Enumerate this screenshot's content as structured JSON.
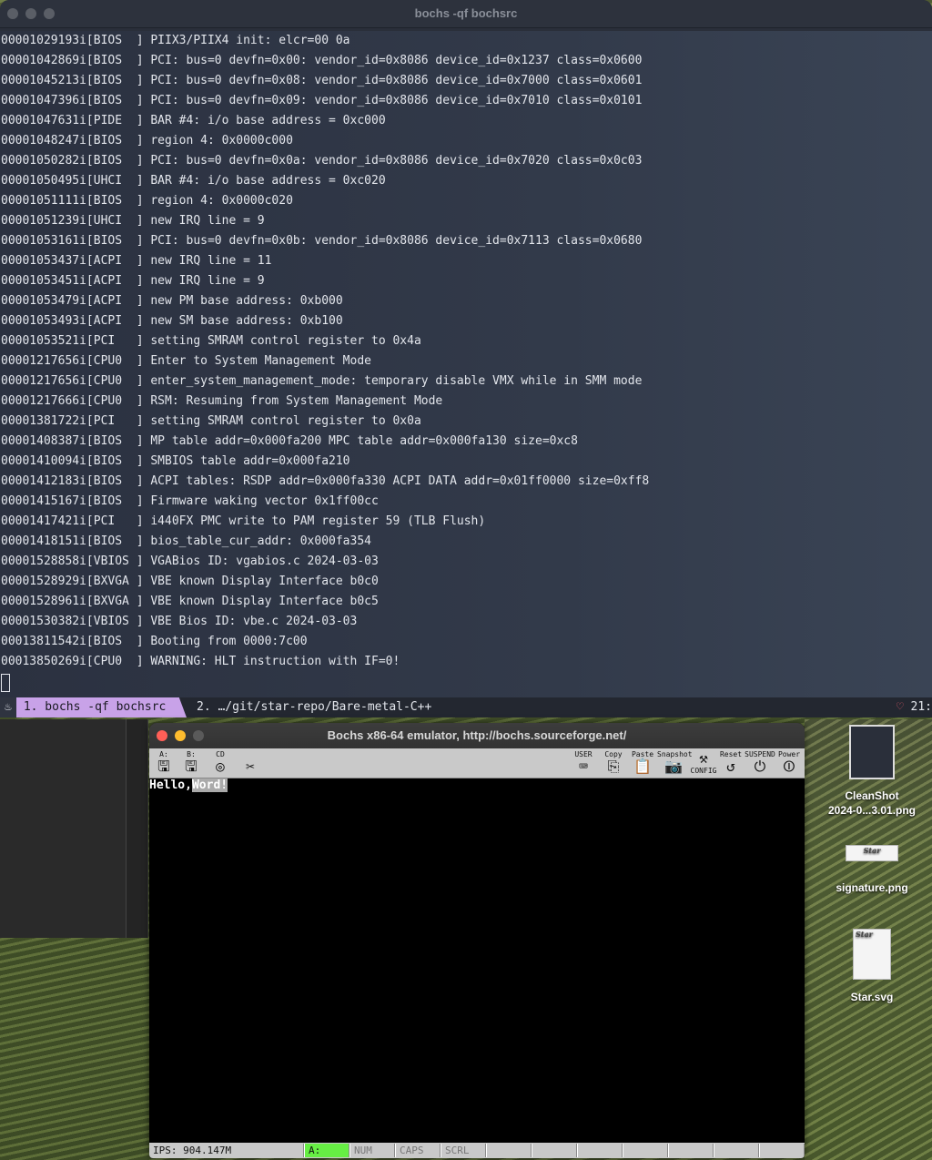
{
  "terminal": {
    "title": "bochs -qf bochsrc",
    "lines": [
      "00001029193i[BIOS  ] PIIX3/PIIX4 init: elcr=00 0a",
      "00001042869i[BIOS  ] PCI: bus=0 devfn=0x00: vendor_id=0x8086 device_id=0x1237 class=0x0600",
      "00001045213i[BIOS  ] PCI: bus=0 devfn=0x08: vendor_id=0x8086 device_id=0x7000 class=0x0601",
      "00001047396i[BIOS  ] PCI: bus=0 devfn=0x09: vendor_id=0x8086 device_id=0x7010 class=0x0101",
      "00001047631i[PIDE  ] BAR #4: i/o base address = 0xc000",
      "00001048247i[BIOS  ] region 4: 0x0000c000",
      "00001050282i[BIOS  ] PCI: bus=0 devfn=0x0a: vendor_id=0x8086 device_id=0x7020 class=0x0c03",
      "00001050495i[UHCI  ] BAR #4: i/o base address = 0xc020",
      "00001051111i[BIOS  ] region 4: 0x0000c020",
      "00001051239i[UHCI  ] new IRQ line = 9",
      "00001053161i[BIOS  ] PCI: bus=0 devfn=0x0b: vendor_id=0x8086 device_id=0x7113 class=0x0680",
      "00001053437i[ACPI  ] new IRQ line = 11",
      "00001053451i[ACPI  ] new IRQ line = 9",
      "00001053479i[ACPI  ] new PM base address: 0xb000",
      "00001053493i[ACPI  ] new SM base address: 0xb100",
      "00001053521i[PCI   ] setting SMRAM control register to 0x4a",
      "00001217656i[CPU0  ] Enter to System Management Mode",
      "00001217656i[CPU0  ] enter_system_management_mode: temporary disable VMX while in SMM mode",
      "00001217666i[CPU0  ] RSM: Resuming from System Management Mode",
      "00001381722i[PCI   ] setting SMRAM control register to 0x0a",
      "00001408387i[BIOS  ] MP table addr=0x000fa200 MPC table addr=0x000fa130 size=0xc8",
      "00001410094i[BIOS  ] SMBIOS table addr=0x000fa210",
      "00001412183i[BIOS  ] ACPI tables: RSDP addr=0x000fa330 ACPI DATA addr=0x01ff0000 size=0xff8",
      "00001415167i[BIOS  ] Firmware waking vector 0x1ff00cc",
      "00001417421i[PCI   ] i440FX PMC write to PAM register 59 (TLB Flush)",
      "00001418151i[BIOS  ] bios_table_cur_addr: 0x000fa354",
      "00001528858i[VBIOS ] VGABios ID: vgabios.c 2024-03-03",
      "00001528929i[BXVGA ] VBE known Display Interface b0c0",
      "00001528961i[BXVGA ] VBE known Display Interface b0c5",
      "00001530382i[VBIOS ] VBE Bios ID: vbe.c 2024-03-03",
      "00013811542i[BIOS  ] Booting from 0000:7c00",
      "00013850269i[CPU0  ] WARNING: HLT instruction with IF=0!"
    ],
    "tabs": {
      "active": "1. bochs -qf bochsrc",
      "second": "2. …/git/star-repo/Bare-metal-C++",
      "right": "21:"
    }
  },
  "bochs": {
    "title": "Bochs x86-64 emulator, http://bochs.sourceforge.net/",
    "toolbar": {
      "floppy_a": "A:",
      "floppy_b": "B:",
      "cdrom": "CD",
      "user": "USER",
      "copy": "Copy",
      "paste": "Paste",
      "snapshot": "Snapshot",
      "config": "CONFIG",
      "reset": "Reset",
      "suspend": "SUSPEND",
      "power": "Power"
    },
    "screen_text_white": "Hello,",
    "screen_text_gray": "Word!",
    "status": {
      "ips": "IPS: 904.147M",
      "drive": "A:",
      "num": "NUM",
      "caps": "CAPS",
      "scrl": "SCRL"
    }
  },
  "desktop": {
    "icons": [
      {
        "label": "CleanShot\n2024-0...3.01.png"
      },
      {
        "label": "signature.png"
      },
      {
        "label": "Star.svg"
      }
    ]
  }
}
